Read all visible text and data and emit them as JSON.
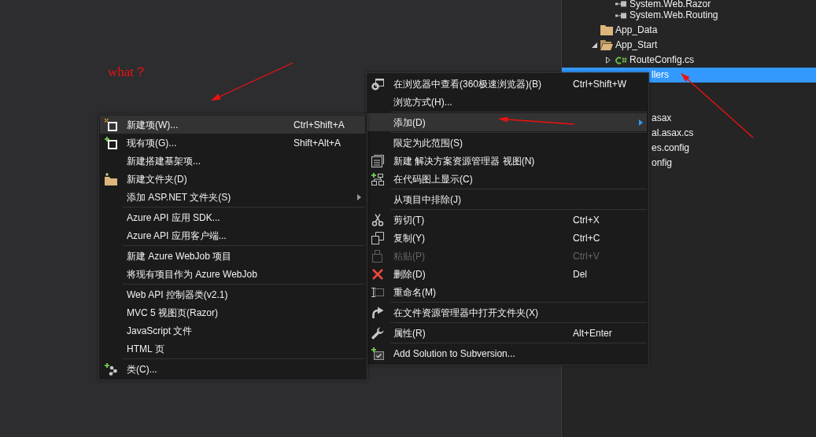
{
  "editor": {
    "annotation": {
      "text": "what？"
    }
  },
  "solution_explorer": {
    "tree": [
      {
        "kind": "group",
        "children": [
          {
            "kind": "reference",
            "label": "System.Web.Razor",
            "selected": false
          },
          {
            "kind": "reference",
            "label": "System.Web.Routing",
            "selected": false
          }
        ]
      },
      {
        "kind": "folder",
        "label": "App_Data",
        "selected": false
      },
      {
        "kind": "folder",
        "label": "App_Start",
        "selected": false,
        "expanded": true,
        "children": [
          {
            "kind": "code-file",
            "label": "RouteConfig.cs",
            "selected": false,
            "expanded": false
          }
        ]
      },
      {
        "kind": "covered",
        "label": "llers",
        "selected": true
      }
    ],
    "rows_beside_menu": [
      {
        "label": "asax",
        "selected": false
      },
      {
        "label": "al.asax.cs",
        "selected": false
      },
      {
        "label": "es.config",
        "selected": false
      },
      {
        "label": "onfig",
        "selected": false
      }
    ]
  },
  "context_menu": {
    "groups": [
      {
        "items": [
          {
            "label": "在浏览器中查看(360极速浏览器)(B)",
            "shortcut": "Ctrl+Shift+W",
            "selected": false,
            "disabled": false,
            "submenu": false
          },
          {
            "label": "浏览方式(H)...",
            "selected": false,
            "disabled": false,
            "submenu": false
          }
        ]
      },
      {
        "items": [
          {
            "label": "添加(D)",
            "selected": true,
            "disabled": false,
            "submenu": true
          }
        ]
      },
      {
        "items": [
          {
            "label": "限定为此范围(S)",
            "selected": false,
            "disabled": false,
            "submenu": false
          },
          {
            "label": "新建 解决方案资源管理器 视图(N)",
            "selected": false,
            "disabled": false,
            "submenu": false
          },
          {
            "label": "在代码图上显示(C)",
            "selected": false,
            "disabled": false,
            "submenu": false
          }
        ]
      },
      {
        "items": [
          {
            "label": "从项目中排除(J)",
            "selected": false,
            "disabled": false,
            "submenu": false
          }
        ]
      },
      {
        "items": [
          {
            "label": "剪切(T)",
            "shortcut": "Ctrl+X",
            "selected": false,
            "disabled": false,
            "submenu": false
          },
          {
            "label": "复制(Y)",
            "shortcut": "Ctrl+C",
            "selected": false,
            "disabled": false,
            "submenu": false
          },
          {
            "label": "粘贴(P)",
            "shortcut": "Ctrl+V",
            "selected": false,
            "disabled": true,
            "submenu": false
          },
          {
            "label": "删除(D)",
            "shortcut": "Del",
            "selected": false,
            "disabled": false,
            "submenu": false
          },
          {
            "label": "重命名(M)",
            "selected": false,
            "disabled": false,
            "submenu": false
          }
        ]
      },
      {
        "items": [
          {
            "label": "在文件资源管理器中打开文件夹(X)",
            "selected": false,
            "disabled": false,
            "submenu": false
          }
        ]
      },
      {
        "items": [
          {
            "label": "属性(R)",
            "shortcut": "Alt+Enter",
            "selected": false,
            "disabled": false,
            "submenu": false
          }
        ]
      },
      {
        "items": [
          {
            "label": "Add Solution to Subversion...",
            "selected": false,
            "disabled": false,
            "submenu": false
          }
        ]
      }
    ]
  },
  "add_submenu": {
    "groups": [
      {
        "items": [
          {
            "label": "新建项(W)...",
            "shortcut": "Ctrl+Shift+A",
            "selected": true,
            "disabled": false,
            "submenu": false
          },
          {
            "label": "现有项(G)...",
            "shortcut": "Shift+Alt+A",
            "selected": false,
            "disabled": false,
            "submenu": false
          },
          {
            "label": "新建搭建基架项...",
            "selected": false,
            "disabled": false,
            "submenu": false
          },
          {
            "label": "新建文件夹(D)",
            "selected": false,
            "disabled": false,
            "submenu": false
          },
          {
            "label": "添加 ASP.NET 文件夹(S)",
            "selected": false,
            "disabled": false,
            "submenu": true
          }
        ]
      },
      {
        "items": [
          {
            "label": "Azure API 应用 SDK...",
            "selected": false,
            "disabled": false,
            "submenu": false
          },
          {
            "label": "Azure API 应用客户端...",
            "selected": false,
            "disabled": false,
            "submenu": false
          }
        ]
      },
      {
        "items": [
          {
            "label": "新建 Azure WebJob 项目",
            "selected": false,
            "disabled": false,
            "submenu": false
          },
          {
            "label": "将现有项目作为 Azure WebJob",
            "selected": false,
            "disabled": false,
            "submenu": false
          }
        ]
      },
      {
        "items": [
          {
            "label": "Web API 控制器类(v2.1)",
            "selected": false,
            "disabled": false,
            "submenu": false
          },
          {
            "label": "MVC 5 视图页(Razor)",
            "selected": false,
            "disabled": false,
            "submenu": false
          },
          {
            "label": "JavaScript 文件",
            "selected": false,
            "disabled": false,
            "submenu": false
          },
          {
            "label": "HTML 页",
            "selected": false,
            "disabled": false,
            "submenu": false
          }
        ]
      },
      {
        "items": [
          {
            "label": "类(C)...",
            "selected": false,
            "disabled": false,
            "submenu": false
          }
        ]
      }
    ]
  }
}
